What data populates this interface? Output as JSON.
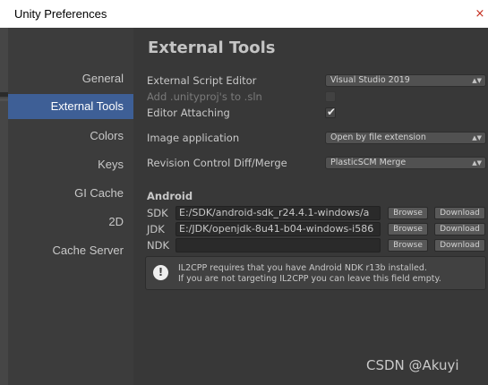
{
  "window": {
    "title": "Unity Preferences",
    "close_glyph": "×"
  },
  "sidebar": {
    "items": [
      {
        "label": "General",
        "selected": false
      },
      {
        "label": "External Tools",
        "selected": true
      },
      {
        "label": "Colors",
        "selected": false
      },
      {
        "label": "Keys",
        "selected": false
      },
      {
        "label": "GI Cache",
        "selected": false
      },
      {
        "label": "2D",
        "selected": false
      },
      {
        "label": "Cache Server",
        "selected": false
      }
    ]
  },
  "main": {
    "heading": "External Tools",
    "external_script_editor": {
      "label": "External Script Editor",
      "value": "Visual Studio 2019"
    },
    "add_unityproj": {
      "label": "Add .unityproj's to .sln",
      "checked": false,
      "enabled": false
    },
    "editor_attaching": {
      "label": "Editor Attaching",
      "checked": true,
      "tick": "✔"
    },
    "image_application": {
      "label": "Image application",
      "value": "Open by file extension"
    },
    "revision_control": {
      "label": "Revision Control Diff/Merge",
      "value": "PlasticSCM Merge"
    },
    "dropdown_arrow": "▲▼",
    "android": {
      "title": "Android",
      "sdk": {
        "label": "SDK",
        "path": "E:/SDK/android-sdk_r24.4.1-windows/a"
      },
      "jdk": {
        "label": "JDK",
        "path": "E:/JDK/openjdk-8u41-b04-windows-i586"
      },
      "ndk": {
        "label": "NDK",
        "path": ""
      },
      "browse_label": "Browse",
      "download_label": "Download"
    },
    "help": {
      "icon": "!",
      "line1": "IL2CPP requires that you have Android NDK r13b installed.",
      "line2": "If you are not targeting IL2CPP you can leave this field empty."
    }
  },
  "watermark": "CSDN @Akuyi",
  "colors": {
    "sidebar_bg": "#3c3c3c",
    "content_bg": "#383838",
    "selection": "#3e5f96",
    "text": "#c8c8c8"
  }
}
